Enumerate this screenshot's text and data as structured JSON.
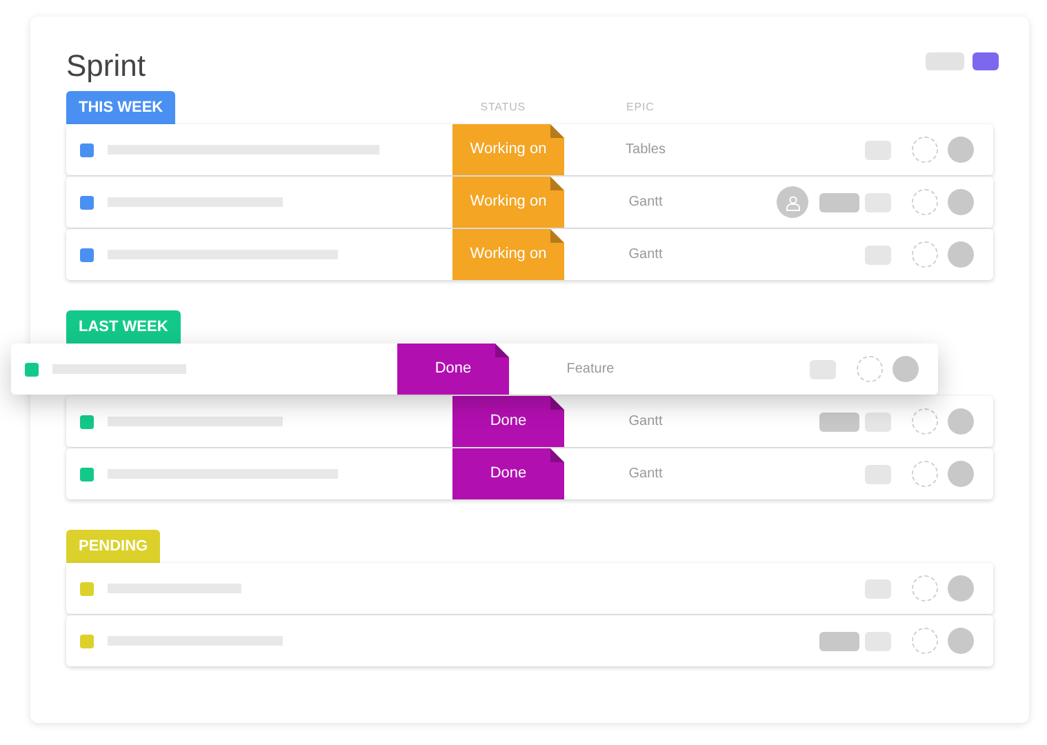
{
  "title": "Sprint",
  "view_toggle": [
    {
      "selected": false
    },
    {
      "selected": true
    }
  ],
  "columns": [
    "STATUS",
    "EPIC"
  ],
  "groups": [
    {
      "label": "THIS WEEK",
      "color": "#4a90f2",
      "rows": [
        {
          "status": "Working on",
          "color": "#f3a523",
          "epic": "Tables",
          "assignee": false,
          "extra_chip": false,
          "dragged": false
        },
        {
          "status": "Working on",
          "color": "#f3a523",
          "epic": "Gantt",
          "assignee": true,
          "extra_chip": true,
          "dragged": false
        },
        {
          "status": "Working on",
          "color": "#f3a523",
          "epic": "Gantt",
          "assignee": false,
          "extra_chip": false,
          "dragged": false
        }
      ]
    },
    {
      "label": "LAST WEEK",
      "color": "#13c98a",
      "rows": [
        {
          "status": "Done",
          "color": "#b20fb0",
          "epic": "Feature",
          "assignee": false,
          "extra_chip": false,
          "dragged": true
        },
        {
          "status": "Done",
          "color": "#b20fb0",
          "epic": "Gantt",
          "assignee": false,
          "extra_chip": true,
          "dragged": false
        },
        {
          "status": "Done",
          "color": "#b20fb0",
          "epic": "Gantt",
          "assignee": false,
          "extra_chip": false,
          "dragged": false
        }
      ]
    },
    {
      "label": "PENDING",
      "color": "#dcd12a",
      "rows": [
        {
          "assignee": false,
          "extra_chip": false,
          "dragged": false
        },
        {
          "assignee": false,
          "extra_chip": true,
          "dragged": false
        }
      ]
    }
  ]
}
